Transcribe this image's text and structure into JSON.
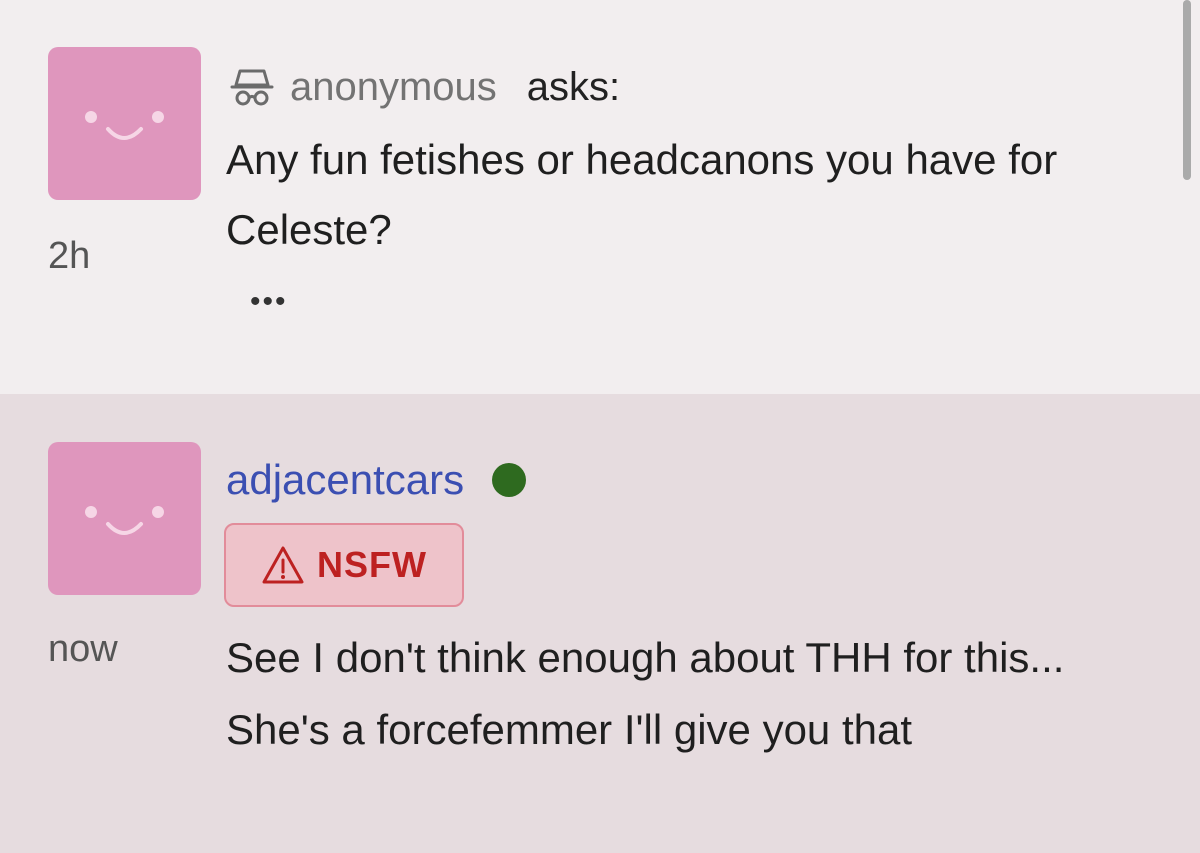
{
  "ask": {
    "asker_icon": "incognito-icon",
    "asker_name": "anonymous",
    "verb": "asks:",
    "question": "Any fun fetishes or headcanons you have for Celeste?",
    "time": "2h",
    "more_label": "•••",
    "avatar_icon": "smiley-avatar"
  },
  "reply": {
    "username": "adjacentcars",
    "online_status": "online",
    "badge_icon": "warning-triangle-icon",
    "badge_label": "NSFW",
    "time": "now",
    "answer": "See I don't think enough about THH for this... She's a forcefemmer I'll give you that",
    "avatar_icon": "smiley-avatar"
  },
  "colors": {
    "ask_background": "#f2eeef",
    "reply_background": "#e6dcdf",
    "avatar": "#df96bd",
    "username": "#3b4fb2",
    "online_dot": "#2e6a1f",
    "nsfw_text": "#bd2121",
    "nsfw_background": "#eec3ca"
  }
}
